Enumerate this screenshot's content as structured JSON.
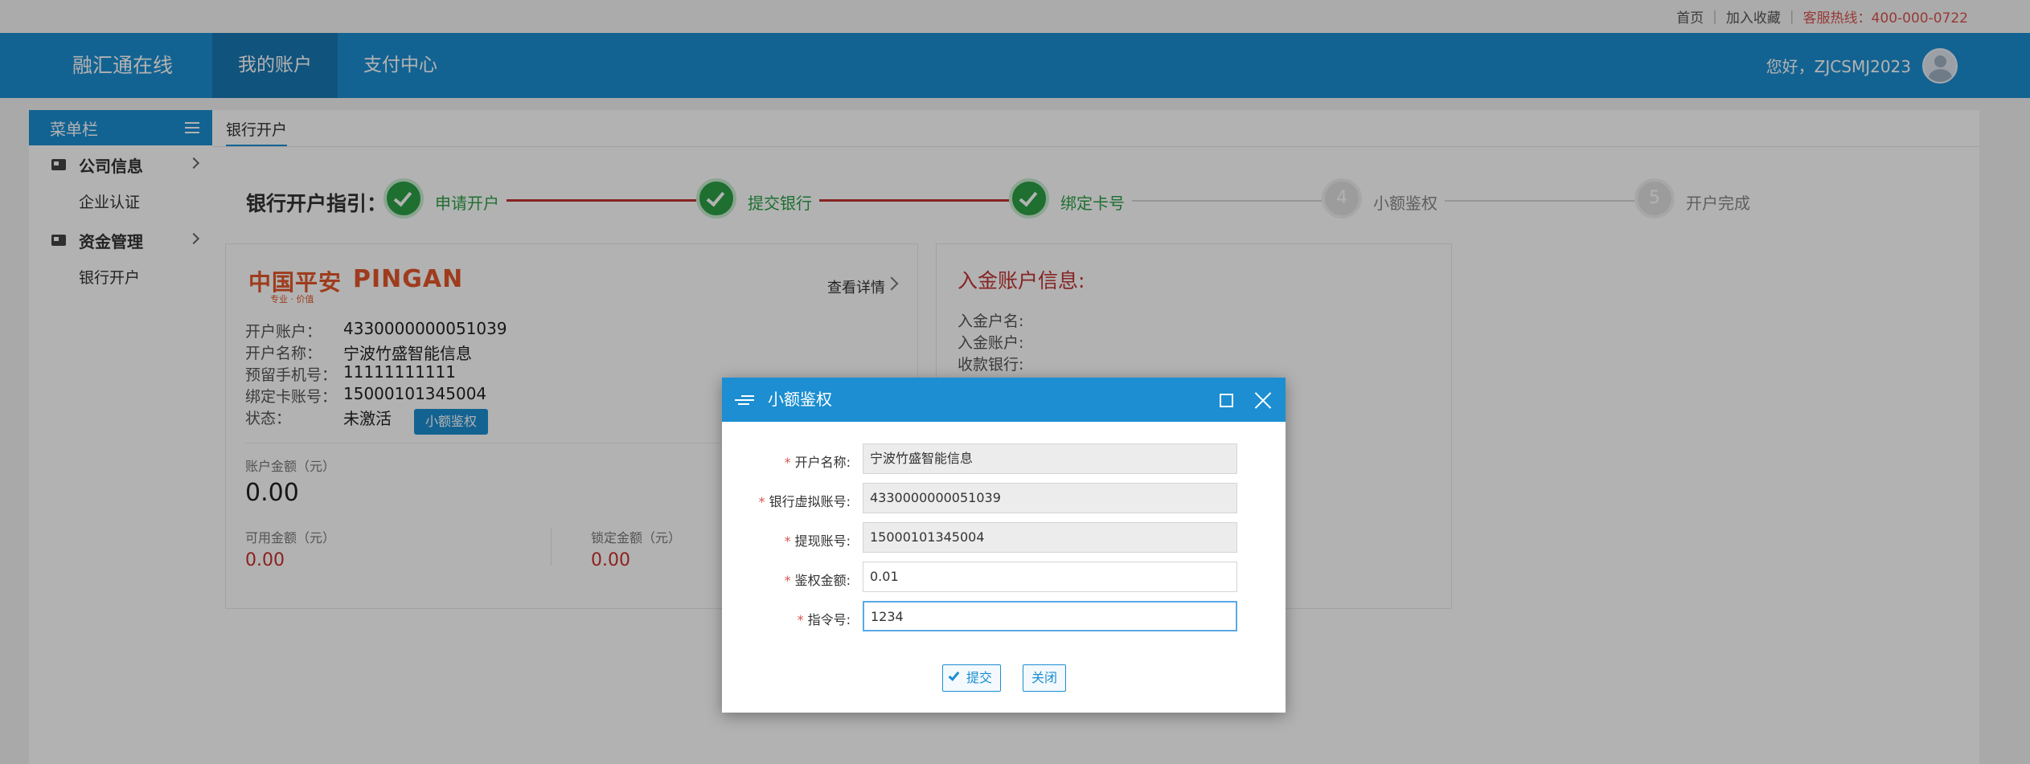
{
  "topbar": {
    "home": "首页",
    "favorite": "加入收藏",
    "hotline": "客服热线：400-000-0722"
  },
  "header": {
    "brand": "融汇通在线",
    "nav": [
      "我的账户",
      "支付中心"
    ],
    "greeting": "您好，ZJCSMJ2023"
  },
  "sidebar": {
    "title": "菜单栏",
    "groups": [
      {
        "label": "公司信息",
        "sub": "企业认证"
      },
      {
        "label": "资金管理",
        "sub": "银行开户"
      }
    ]
  },
  "main": {
    "tab": "银行开户",
    "guide_title": "银行开户指引：",
    "steps": [
      {
        "num": "1",
        "label": "申请开户",
        "done": true
      },
      {
        "num": "2",
        "label": "提交银行",
        "done": true
      },
      {
        "num": "3",
        "label": "绑定卡号",
        "done": true
      },
      {
        "num": "4",
        "label": "小额鉴权",
        "done": false
      },
      {
        "num": "5",
        "label": "开户完成",
        "done": false
      }
    ]
  },
  "bank_card": {
    "logo_cn": "中国平安",
    "logo_en": "PINGAN",
    "logo_tag": "专业 · 价值",
    "detail_link": "查看详情",
    "rows": [
      {
        "label": "开户账户：",
        "value": "4330000000051039"
      },
      {
        "label": "开户名称：",
        "value": "宁波竹盛智能信息"
      },
      {
        "label": "预留手机号：",
        "value": "11111111111"
      },
      {
        "label": "绑定卡账号：",
        "value": "15000101345004"
      },
      {
        "label": "状态：",
        "value": "未激活"
      }
    ],
    "auth_button": "小额鉴权",
    "balance_label": "账户金额（元）",
    "balance": "0.00",
    "available_label": "可用金额（元）",
    "available": "0.00",
    "locked_label": "锁定金额（元）",
    "locked": "0.00"
  },
  "deposit_card": {
    "title": "入金账户信息:",
    "rows": [
      "入金户名:",
      "入金账户:",
      "收款银行:"
    ]
  },
  "dialog": {
    "title": "小额鉴权",
    "fields": [
      {
        "label": "开户名称:",
        "value": "宁波竹盛智能信息"
      },
      {
        "label": "银行虚拟账号:",
        "value": "4330000000051039"
      },
      {
        "label": "提现账号:",
        "value": "15000101345004"
      },
      {
        "label": "鉴权金额:",
        "value": "0.01"
      },
      {
        "label": "指令号:",
        "value": "1234"
      }
    ],
    "submit": "提交",
    "close": "关闭"
  },
  "colors": {
    "primary": "#1c8ed1",
    "step_done": "#2ba046",
    "progress_line": "#c13434",
    "amount_red": "#c9302c",
    "brand_orange": "#e2572a"
  }
}
